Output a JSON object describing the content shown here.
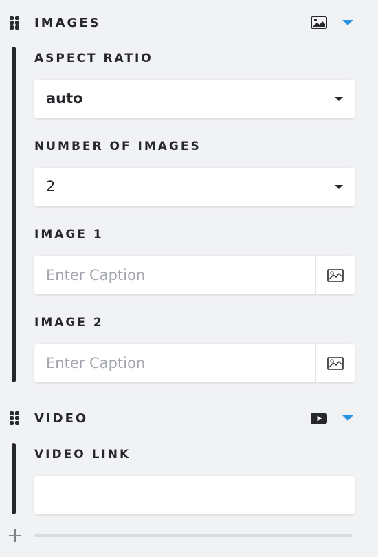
{
  "sections": {
    "images": {
      "title": "IMAGES",
      "icon": "image-icon",
      "toggle_icon": "caret-down-icon",
      "aspect_ratio": {
        "label": "ASPECT RATIO",
        "value": "auto"
      },
      "number_of_images": {
        "label": "NUMBER OF IMAGES",
        "value": "2"
      },
      "image_1": {
        "label": "IMAGE 1",
        "placeholder": "Enter Caption",
        "value": "",
        "picker_icon": "image-picker-icon"
      },
      "image_2": {
        "label": "IMAGE 2",
        "placeholder": "Enter Caption",
        "value": "",
        "picker_icon": "image-picker-icon"
      }
    },
    "video": {
      "title": "VIDEO",
      "icon": "youtube-icon",
      "toggle_icon": "caret-down-icon",
      "video_link": {
        "label": "VIDEO LINK",
        "value": ""
      }
    }
  },
  "footer": {
    "add_icon": "plus-icon"
  },
  "colors": {
    "accent": "#2a93e2",
    "text": "#26272b",
    "background": "#f1f2f3",
    "placeholder": "#a3a6ad",
    "divider": "#d6dbde"
  }
}
